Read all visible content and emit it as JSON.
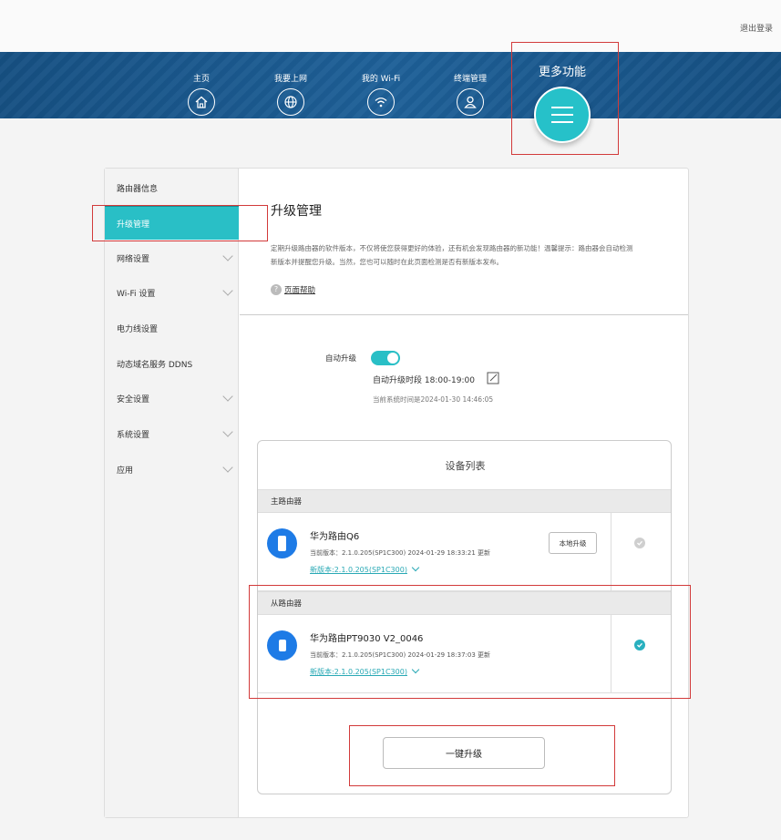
{
  "header": {
    "logout": "退出登录"
  },
  "nav": {
    "items": [
      {
        "label": "主页",
        "icon": "home-icon"
      },
      {
        "label": "我要上网",
        "icon": "globe-icon"
      },
      {
        "label": "我的 Wi-Fi",
        "icon": "wifi-icon"
      },
      {
        "label": "终端管理",
        "icon": "user-icon"
      }
    ],
    "more": {
      "label": "更多功能",
      "icon": "menu-icon"
    }
  },
  "sidebar": {
    "items": [
      {
        "label": "路由器信息",
        "expandable": false
      },
      {
        "label": "升级管理",
        "expandable": false,
        "active": true
      },
      {
        "label": "网络设置",
        "expandable": true
      },
      {
        "label": "Wi-Fi 设置",
        "expandable": true
      },
      {
        "label": "电力线设置",
        "expandable": false
      },
      {
        "label": "动态域名服务 DDNS",
        "expandable": false
      },
      {
        "label": "安全设置",
        "expandable": true
      },
      {
        "label": "系统设置",
        "expandable": true
      },
      {
        "label": "应用",
        "expandable": true
      }
    ]
  },
  "main": {
    "title": "升级管理",
    "desc_line1": "定期升级路由器的软件版本，不仅将使您获得更好的体验，还有机会发现路由器的新功能！温馨提示：路由器会自动检测",
    "desc_line2": "新版本并提醒您升级。当然，您也可以随时在此页面检测是否有新版本发布。",
    "help": "页面帮助",
    "auto_upgrade_label": "自动升级",
    "auto_upgrade_on": true,
    "auto_upgrade_time": "自动升级时段 18:00-19:00",
    "system_time": "当前系统时间是2024-01-30 14:46:05"
  },
  "device_list": {
    "title": "设备列表",
    "main_router_header": "主路由器",
    "sub_router_header": "从路由器",
    "main_router": {
      "name": "华为路由Q6",
      "current": "当前版本：2.1.0.205(SP1C300) 2024-01-29 18:33:21 更新",
      "new_version": "新版本:2.1.0.205(SP1C300)",
      "local_button": "本地升级",
      "selected": false
    },
    "sub_router": {
      "name": "华为路由PT9030 V2_0046",
      "current": "当前版本：2.1.0.205(SP1C300) 2024-01-29 18:37:03 更新",
      "new_version": "新版本:2.1.0.205(SP1C300)",
      "selected": true
    },
    "one_click_upgrade": "一键升级"
  },
  "colors": {
    "nav_blue": "#1e6098",
    "accent_teal": "#29bfc6",
    "highlight_red": "#d23a3a"
  }
}
